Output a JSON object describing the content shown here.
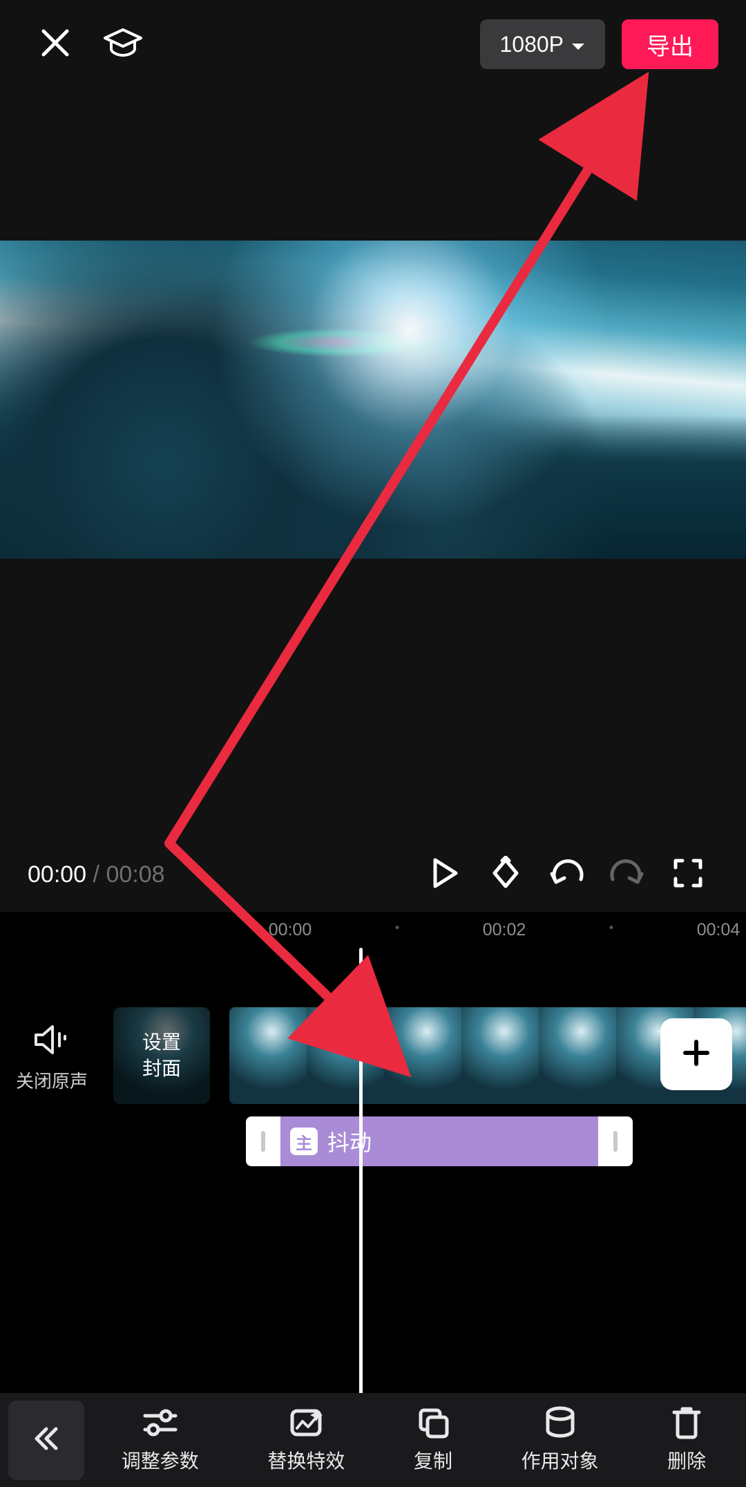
{
  "header": {
    "resolution_label": "1080P",
    "export_label": "导出"
  },
  "playback": {
    "current_time": "00:00",
    "separator": " / ",
    "total_time": "00:08"
  },
  "ruler": {
    "labels": [
      "00:00",
      "00:02",
      "00:04"
    ]
  },
  "tracks": {
    "audio_toggle_label": "关闭原声",
    "cover_line1": "设置",
    "cover_line2": "封面",
    "effect_tag": "主",
    "effect_name": "抖动"
  },
  "toolbar": {
    "items": [
      {
        "id": "adjust-params",
        "label": "调整参数"
      },
      {
        "id": "replace-effect",
        "label": "替换特效"
      },
      {
        "id": "copy",
        "label": "复制"
      },
      {
        "id": "target-object",
        "label": "作用对象"
      },
      {
        "id": "delete",
        "label": "删除"
      }
    ]
  },
  "colors": {
    "accent": "#ff1a57",
    "effect_purple": "#a98bd6",
    "arrow": "#ea2a3f"
  }
}
